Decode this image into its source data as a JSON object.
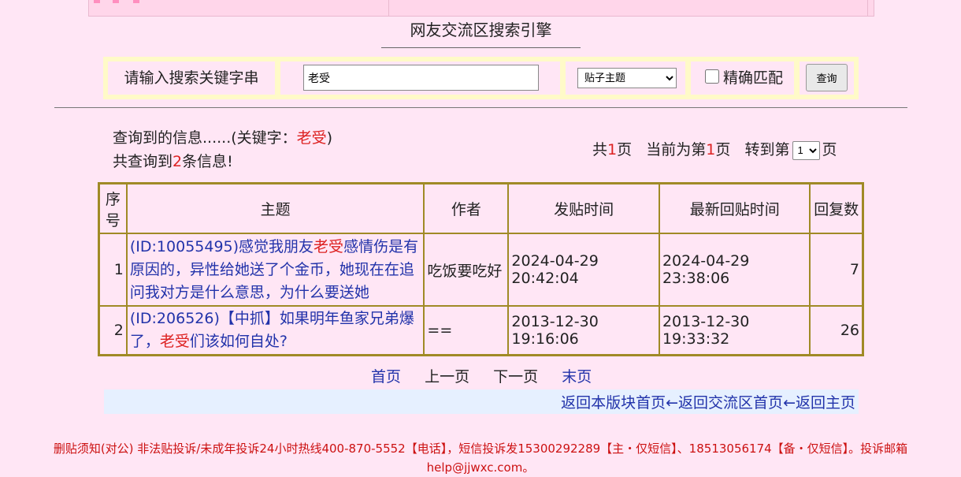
{
  "page_title": "网友交流区搜索引擎",
  "search": {
    "label": "请输入搜索关键字串",
    "keyword_value": "老受",
    "scope_selected": "贴子主题",
    "exact_label": "精确匹配",
    "exact_checked": false,
    "button_label": "查询"
  },
  "result_info": {
    "line1_prefix": "查询到的信息......(关键字：",
    "keyword": "老受",
    "line1_suffix": ")",
    "line2_prefix": "共查询到",
    "count": "2",
    "line2_suffix": "条信息!"
  },
  "pager": {
    "total_prefix": "共",
    "total_pages": "1",
    "total_suffix": "页",
    "current_prefix": "当前为第",
    "current_page": "1",
    "current_suffix": "页",
    "jump_prefix": "转到第",
    "jump_selected": "1",
    "jump_suffix": "页"
  },
  "table": {
    "headers": {
      "index": "序号",
      "topic": "主题",
      "author": "作者",
      "post_time": "发贴时间",
      "reply_time": "最新回贴时间",
      "reply_count": "回复数"
    },
    "rows": [
      {
        "index": "1",
        "topic_before": "(ID:10055495)感觉我朋友",
        "topic_highlight": "老受",
        "topic_after": "感情伤是有原因的，异性给她送了个金币，她现在在追问我对方是什么意思，为什么要送她",
        "author": "吃饭要吃好",
        "post_time": "2024-04-29 20:42:04",
        "reply_time": "2024-04-29 23:38:06",
        "reply_count": "7"
      },
      {
        "index": "2",
        "topic_before": "(ID:206526)【中抓】如果明年鱼家兄弟爆了，",
        "topic_highlight": "老受",
        "topic_after": "们该如何自处?",
        "author": "==",
        "post_time": "2013-12-30 19:16:06",
        "reply_time": "2013-12-30 19:33:32",
        "reply_count": "26"
      }
    ]
  },
  "bottom_nav": {
    "first": "首页",
    "prev": "上一页",
    "next": "下一页",
    "last": "末页"
  },
  "return_links": {
    "board_home": "返回本版块首页",
    "arrow1": "←",
    "forum_home": "返回交流区首页",
    "arrow2": "←",
    "main_home": "返回主页"
  },
  "footer_notice": "删贴须知(对公) 非法贴投诉/未成年投诉24小时热线400-870-5552【电话】，短信投诉发15300292289【主・仅短信】、18513056174【备・仅短信】。投诉邮箱help@jjwxc.com。",
  "colors": {
    "background": "#ffe6f5",
    "table_border": "#a08a26",
    "link": "#2233aa",
    "highlight": "#dd2222",
    "form_frame": "#fffac8"
  }
}
